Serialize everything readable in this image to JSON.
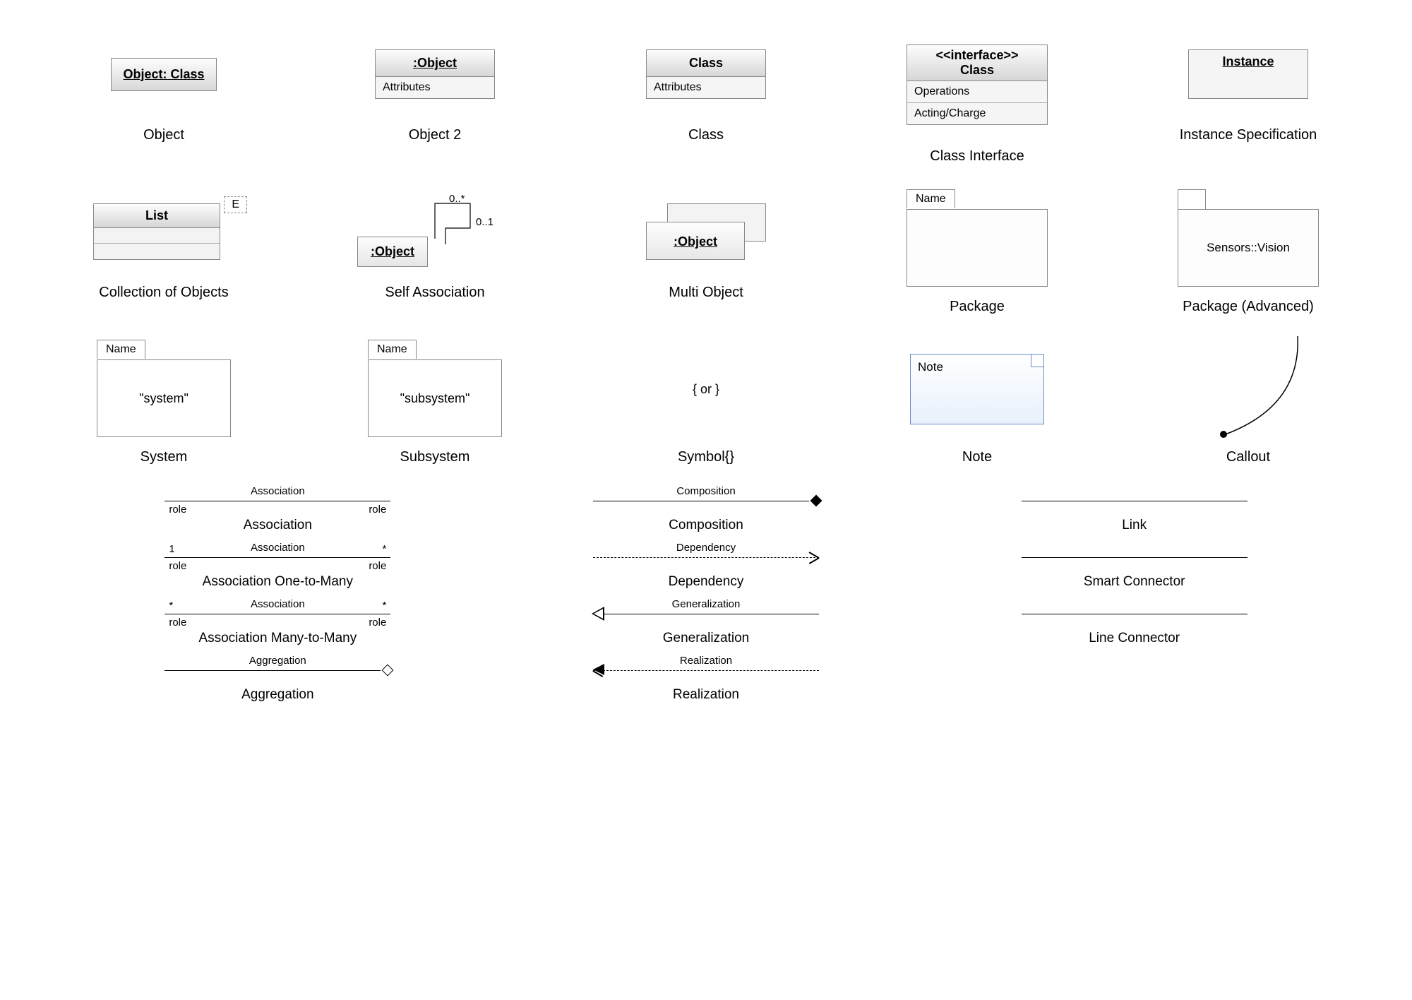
{
  "row1": {
    "object": {
      "header": "Object: Class",
      "caption": "Object"
    },
    "object2": {
      "header": ":Object",
      "attr": "Attributes",
      "caption": "Object 2"
    },
    "class": {
      "header": "Class",
      "attr": "Attributes",
      "caption": "Class"
    },
    "classInterface": {
      "stereo": "<<interface>>",
      "name": "Class",
      "op": "Operations",
      "act": "Acting/Charge",
      "caption": "Class Interface"
    },
    "instance": {
      "header": "Instance",
      "caption": "Instance Specification"
    }
  },
  "row2": {
    "collection": {
      "tag": "E",
      "head": "List",
      "caption": "Collection of Objects"
    },
    "selfAssoc": {
      "header": ":Object",
      "m1": "0..*",
      "m2": "0..1",
      "caption": "Self Association"
    },
    "multiObj": {
      "header": ":Object",
      "caption": "Multi Object"
    },
    "package": {
      "tab": "Name",
      "caption": "Package"
    },
    "packageAdv": {
      "body": "Sensors::Vision",
      "caption": "Package (Advanced)"
    }
  },
  "row3": {
    "system": {
      "tab": "Name",
      "body": "\"system\"",
      "caption": "System"
    },
    "subsystem": {
      "tab": "Name",
      "body": "\"subsystem\"",
      "caption": "Subsystem"
    },
    "symbol": {
      "text": "{ or }",
      "caption": "Symbol{}"
    },
    "note": {
      "text": "Note",
      "caption": "Note"
    },
    "callout": {
      "caption": "Callout"
    }
  },
  "connectors": {
    "association": {
      "top": "Association",
      "ul": "role",
      "ur": "role",
      "caption": "Association"
    },
    "assoc1M": {
      "top": "Association",
      "ol": "1",
      "or": "*",
      "ul": "role",
      "ur": "role",
      "caption": "Association One-to-Many"
    },
    "assocMM": {
      "top": "Association",
      "ol": "*",
      "or": "*",
      "ul": "role",
      "ur": "role",
      "caption": "Association Many-to-Many"
    },
    "aggregation": {
      "top": "Aggregation",
      "caption": "Aggregation"
    },
    "composition": {
      "top": "Composition",
      "caption": "Composition"
    },
    "dependency": {
      "top": "Dependency",
      "caption": "Dependency"
    },
    "generalization": {
      "top": "Generalization",
      "caption": "Generalization"
    },
    "realization": {
      "top": "Realization",
      "caption": "Realization"
    },
    "link": {
      "caption": "Link"
    },
    "smart": {
      "caption": "Smart Connector"
    },
    "lineConn": {
      "caption": "Line Connector"
    }
  }
}
